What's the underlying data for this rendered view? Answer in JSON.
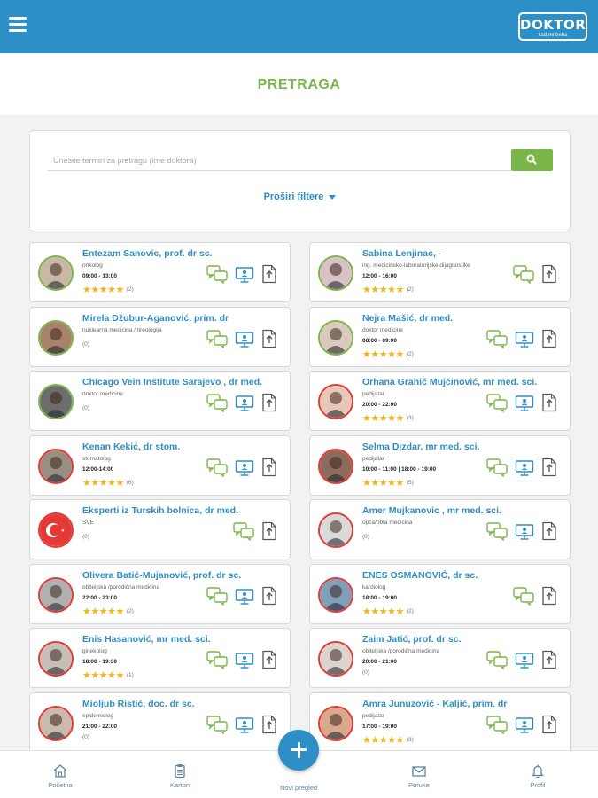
{
  "header": {
    "logo_text": "DOKTOR",
    "logo_tagline": "kad mi treba"
  },
  "page": {
    "title": "PRETRAGA"
  },
  "search": {
    "placeholder": "Unesite termin za pretragu (ime doktora)",
    "value": "",
    "filter_toggle_label": "Proširi filtere"
  },
  "colors": {
    "primary": "#2d8fc5",
    "accent_green": "#7ab648",
    "star": "#f0b51b",
    "avatar_red": "#e53935"
  },
  "doctors": [
    {
      "name": "Entezam Sahovic, prof. dr sc.",
      "specialty": "onkolog",
      "hours": "09:00 - 13:00",
      "rating": 5,
      "rating_stars": "★★★★★",
      "rating_count": "(2)",
      "actions": [
        "chat",
        "video",
        "document"
      ],
      "avatar_border": "green"
    },
    {
      "name": "Sabina Lenjinac, -",
      "specialty": "ing. medicinsko-laboratorijske dijagnostike",
      "hours": "12:00 - 16:00",
      "rating": 5,
      "rating_stars": "★★★★★",
      "rating_count": "(2)",
      "actions": [
        "chat",
        "document"
      ],
      "avatar_border": "green"
    },
    {
      "name": "Mirela Džubur-Aganović, prim. dr",
      "specialty": "nuklearna medicina / tireologija",
      "hours": "",
      "rating": 0,
      "rating_stars": "",
      "rating_count": "(0)",
      "actions": [
        "chat",
        "video",
        "document"
      ],
      "avatar_border": "green"
    },
    {
      "name": "Nejra Mašić, dr med.",
      "specialty": "doktor medicine",
      "hours": "08:00 - 09:00",
      "rating": 5,
      "rating_stars": "★★★★★",
      "rating_count": "(2)",
      "actions": [
        "chat",
        "video",
        "document"
      ],
      "avatar_border": "green"
    },
    {
      "name": "Chicago Vein Institute Sarajevo , dr med.",
      "specialty": "doktor medicine",
      "hours": "",
      "rating": 0,
      "rating_stars": "",
      "rating_count": "(0)",
      "actions": [
        "chat",
        "video",
        "document"
      ],
      "avatar_border": "green"
    },
    {
      "name": "Orhana Grahić Mujčinović, mr med. sci.",
      "specialty": "pedijatar",
      "hours": "20:00 - 22:00",
      "rating": 5,
      "rating_stars": "★★★★★",
      "rating_count": "(3)",
      "actions": [
        "chat",
        "video",
        "document"
      ],
      "avatar_border": "red"
    },
    {
      "name": "Kenan Kekić, dr stom.",
      "specialty": "stomatolog",
      "hours": "12:00-14:00",
      "rating": 5,
      "rating_stars": "★★★★★",
      "rating_count": "(6)",
      "actions": [
        "chat",
        "video",
        "document"
      ],
      "avatar_border": "red"
    },
    {
      "name": "Selma Dizdar, mr med. sci.",
      "specialty": "pedijatar",
      "hours": "10:00 - 11:00 | 18:00 - 19:00",
      "rating": 5,
      "rating_stars": "★★★★★",
      "rating_count": "(5)",
      "actions": [
        "chat",
        "video",
        "document"
      ],
      "avatar_border": "red"
    },
    {
      "name": "Eksperti iz Turskih bolnica, dr med.",
      "specialty": "SVE",
      "hours": "",
      "rating": 0,
      "rating_stars": "",
      "rating_count": "(0)",
      "actions": [
        "chat",
        "document"
      ],
      "avatar_border": "red"
    },
    {
      "name": "Amer Mujkanovic , mr med. sci.",
      "specialty": "opća/pbta medicina",
      "hours": "",
      "rating": 0,
      "rating_stars": "",
      "rating_count": "(0)",
      "actions": [
        "chat",
        "video",
        "document"
      ],
      "avatar_border": "red"
    },
    {
      "name": "Olivera Batić-Mujanović, prof. dr sc.",
      "specialty": "obiteljska /porodična medicina",
      "hours": "22:00 - 23:00",
      "rating": 5,
      "rating_stars": "★★★★★",
      "rating_count": "(2)",
      "actions": [
        "chat",
        "video",
        "document"
      ],
      "avatar_border": "red"
    },
    {
      "name": "ENES OSMANOVIĆ, dr sc.",
      "specialty": "kardiolog",
      "hours": "18:00 - 19:00",
      "rating": 5,
      "rating_stars": "★★★★★",
      "rating_count": "(2)",
      "actions": [
        "chat",
        "document"
      ],
      "avatar_border": "red"
    },
    {
      "name": "Enis Hasanović, mr med. sci.",
      "specialty": "ginekolog",
      "hours": "18:00 - 19:30",
      "rating": 5,
      "rating_stars": "★★★★★",
      "rating_count": "(1)",
      "actions": [
        "chat",
        "video",
        "document"
      ],
      "avatar_border": "red"
    },
    {
      "name": "Zaim Jatić, prof. dr sc.",
      "specialty": "obiteljska /porodična medicina",
      "hours": "20:00 - 21:00",
      "rating": 0,
      "rating_stars": "",
      "rating_count": "(0)",
      "actions": [
        "chat",
        "video",
        "document"
      ],
      "avatar_border": "red"
    },
    {
      "name": "Mioljub Ristić, doc. dr sc.",
      "specialty": "epidemiolog",
      "hours": "21:00 - 22:00",
      "rating": 0,
      "rating_stars": "",
      "rating_count": "(0)",
      "actions": [
        "chat",
        "video",
        "document"
      ],
      "avatar_border": "red"
    },
    {
      "name": "Amra Junuzović - Kaljić, prim. dr",
      "specialty": "pedijatar",
      "hours": "17:00 - 19:00",
      "rating": 5,
      "rating_stars": "★★★★★",
      "rating_count": "(3)",
      "actions": [
        "chat",
        "video",
        "document"
      ],
      "avatar_border": "red"
    }
  ],
  "bottom_nav": {
    "home_label": "Početna",
    "karton_label": "Karton",
    "new_exam_label": "Novi pregled",
    "messages_label": "Poruke",
    "profile_label": "Profil"
  }
}
